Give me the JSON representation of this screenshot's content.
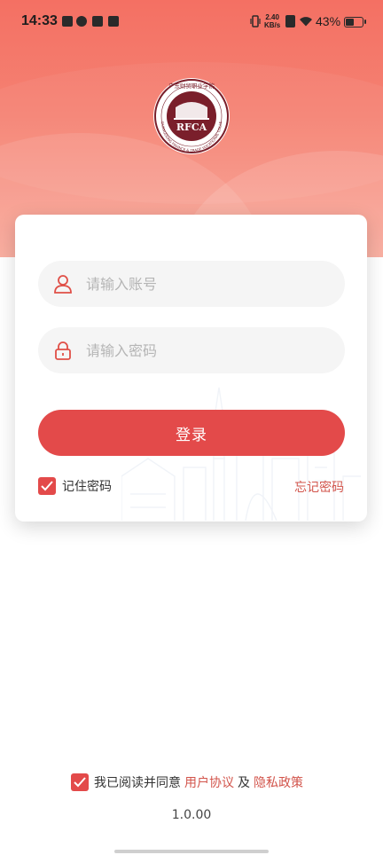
{
  "status_bar": {
    "time": "14:33",
    "net_speed_value": "2.40",
    "net_speed_unit": "KB/s",
    "battery_percent": "43%",
    "battery_level": 0.43
  },
  "logo": {
    "text_top": "广东财贸职业学院",
    "text_ring": "GUANGDONG FINANCE & TRADE VOCATIONAL COLLEGE",
    "monogram": "RFCA"
  },
  "login": {
    "account_placeholder": "请输入账号",
    "password_placeholder": "请输入密码",
    "submit_label": "登录",
    "remember_label": "记住密码",
    "remember_checked": true,
    "forgot_label": "忘记密码"
  },
  "agreement": {
    "prefix": "我已阅读并同意",
    "user_agreement": "用户协议",
    "conjunction": "及",
    "privacy_policy": "隐私政策",
    "checked": true
  },
  "version": "1.0.00",
  "colors": {
    "primary": "#e34a4a",
    "link": "#d2544b",
    "header_top": "#f47063",
    "header_bottom": "#f9a697",
    "logo_maroon": "#7a1f2b"
  }
}
